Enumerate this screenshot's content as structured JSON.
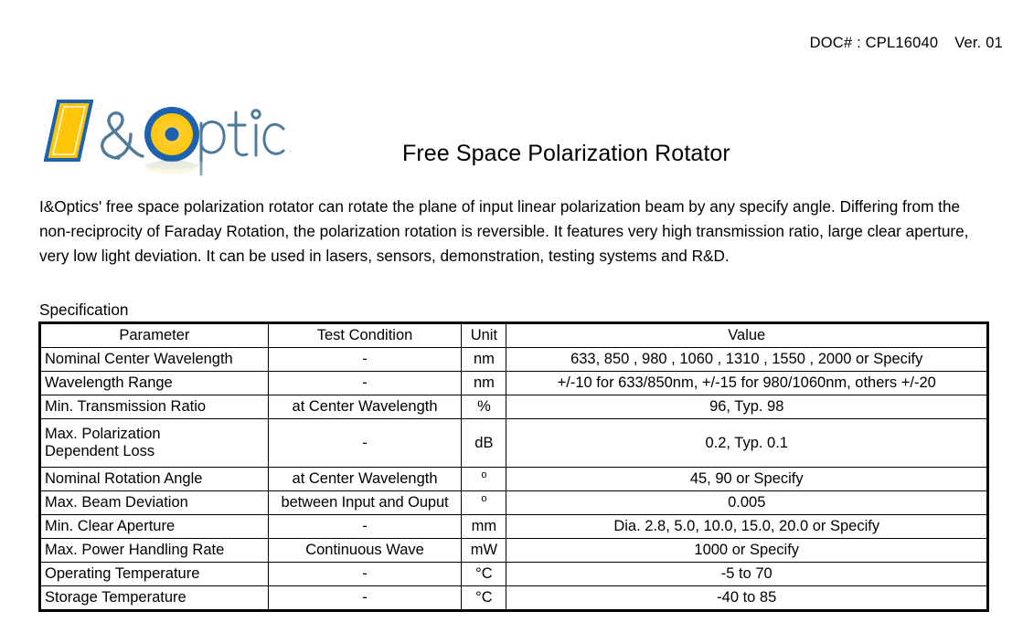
{
  "header": {
    "doc_number": "DOC# : CPL16040",
    "version": "Ver. 01"
  },
  "logo": {
    "text": "I&Optics",
    "colors": {
      "yellow": "#FDC608",
      "blue": "#1D62B0",
      "outline": "#4E7A9B"
    }
  },
  "title": "Free Space Polarization Rotator",
  "intro": "I&Optics' free space polarization rotator can rotate the plane of input linear polarization beam by any specify angle. Differing from the non-reciprocity of Faraday Rotation,  the polarization rotation is reversible. It features very high transmission ratio, large clear aperture, very low light deviation. It can be used in lasers, sensors, demonstration, testing systems and R&D.",
  "spec_heading": "Specification",
  "table": {
    "columns": [
      "Parameter",
      "Test Condition",
      "Unit",
      "Value"
    ],
    "rows": [
      {
        "parameter": "Nominal Center Wavelength",
        "condition": "-",
        "unit": "nm",
        "value": "633, 850 , 980 , 1060 , 1310 , 1550 , 2000 or Specify"
      },
      {
        "parameter": "Wavelength Range",
        "condition": "-",
        "unit": "nm",
        "value": "+/-10 for 633/850nm, +/-15 for 980/1060nm, others +/-20"
      },
      {
        "parameter": "Min. Transmission Ratio",
        "condition": "at Center Wavelength",
        "unit": "%",
        "value": "96, Typ. 98"
      },
      {
        "parameter": "Max. Polarization Dependent Loss",
        "parameter_line1": "Max. Polarization",
        "parameter_line2": "Dependent Loss",
        "condition": "-",
        "unit": "dB",
        "value": "0.2, Typ. 0.1"
      },
      {
        "parameter": "Nominal Rotation Angle",
        "condition": "at Center Wavelength",
        "unit": "o",
        "value": "45, 90 or Specify"
      },
      {
        "parameter": "Max. Beam Deviation",
        "condition": "between Input and Ouput",
        "unit": "o",
        "value": "0.005"
      },
      {
        "parameter": "Min. Clear Aperture",
        "condition": "-",
        "unit": "mm",
        "value": "Dia. 2.8, 5.0, 10.0, 15.0, 20.0 or Specify"
      },
      {
        "parameter": "Max. Power Handling Rate",
        "condition": "Continuous Wave",
        "unit": "mW",
        "value": "1000 or Specify"
      },
      {
        "parameter": "Operating Temperature",
        "condition": "-",
        "unit": "°C",
        "value": "-5 to 70"
      },
      {
        "parameter": "Storage Temperature",
        "condition": "-",
        "unit": "°C",
        "value": "-40 to 85"
      }
    ]
  }
}
